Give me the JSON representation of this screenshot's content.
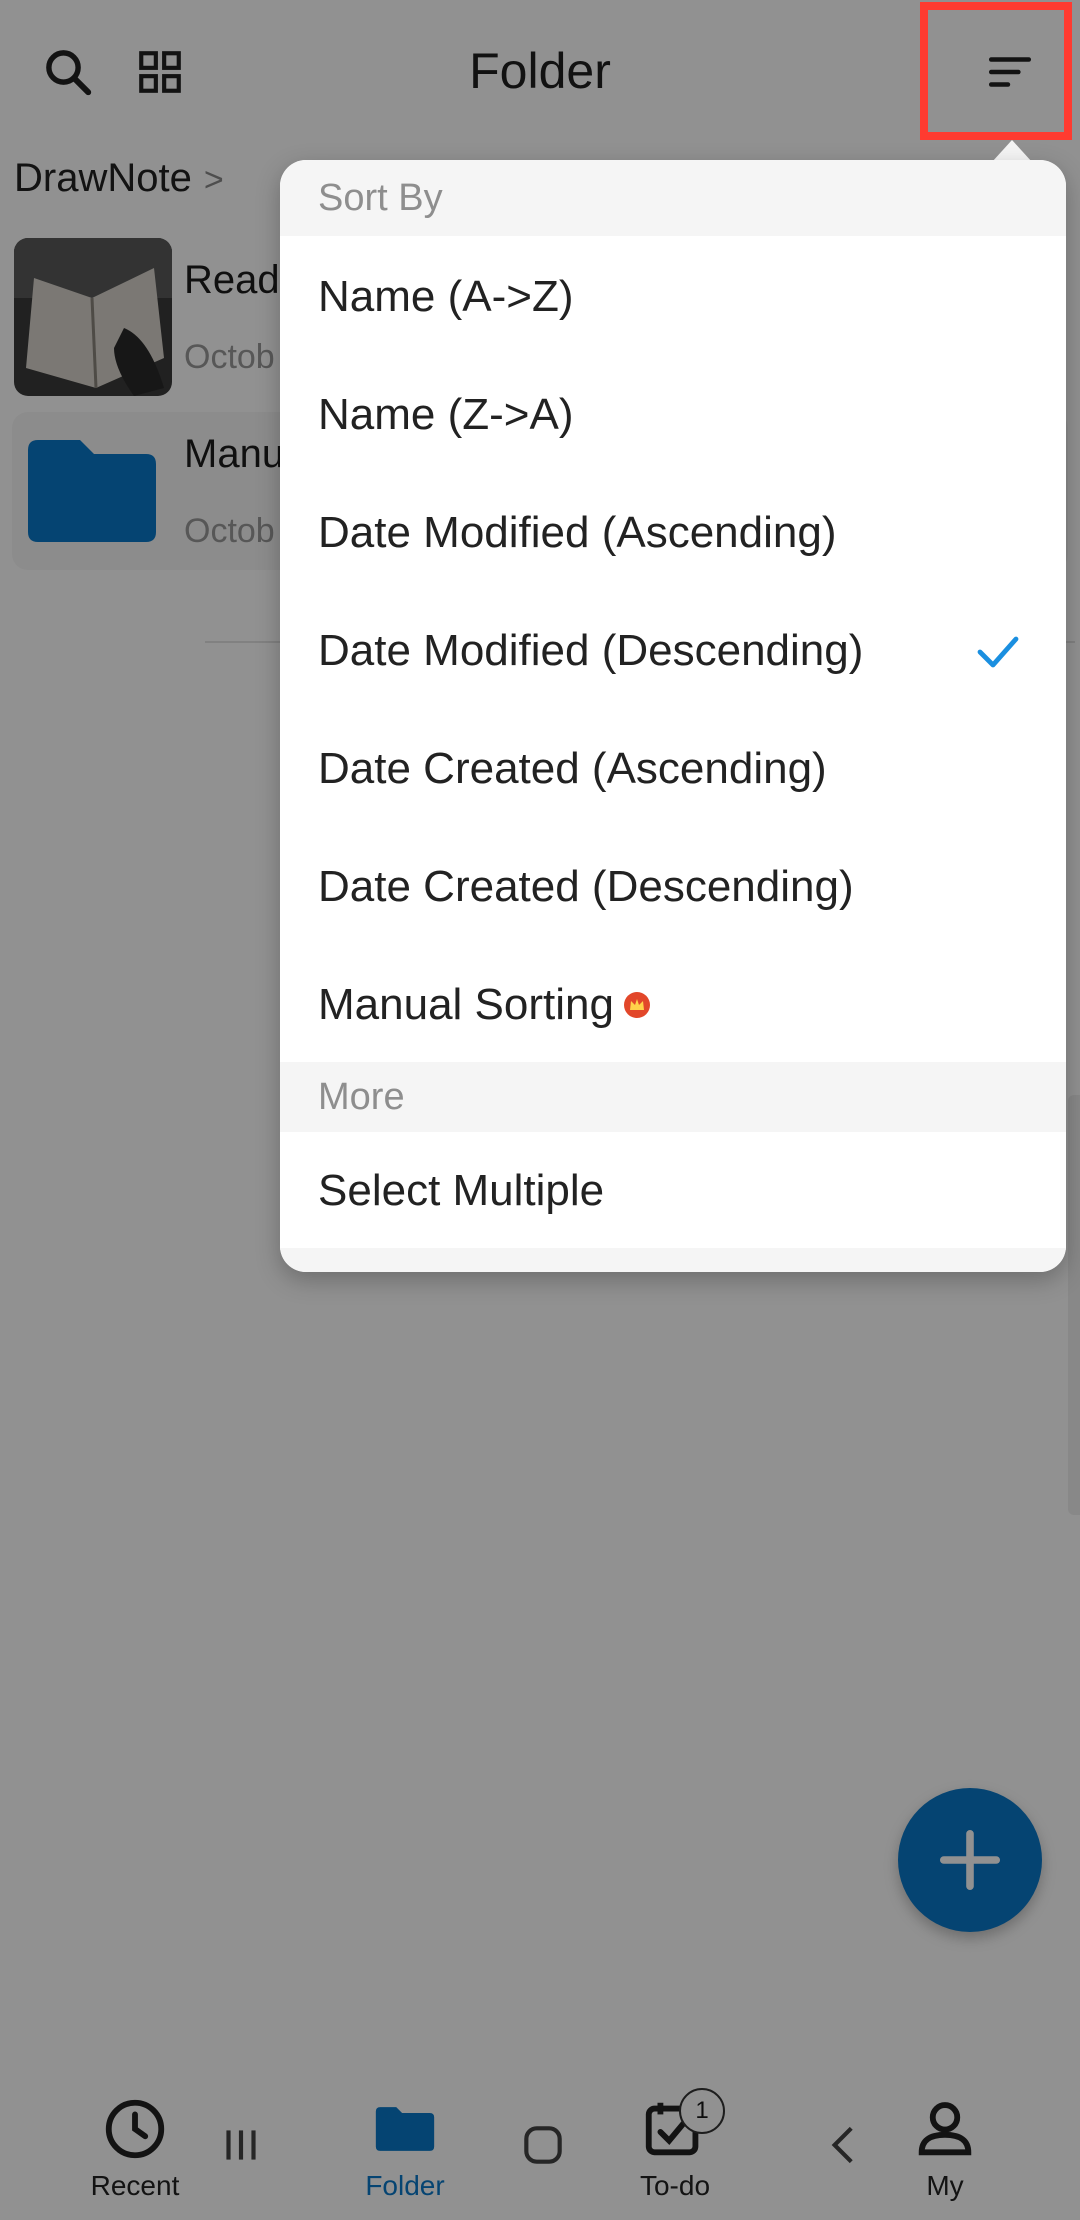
{
  "header": {
    "title": "Folder"
  },
  "breadcrumb": {
    "root": "DrawNote",
    "separator": ">"
  },
  "items": [
    {
      "name": "Readi",
      "date": "Octob"
    },
    {
      "name": "Manu",
      "date": "Octob"
    }
  ],
  "menu": {
    "sort_header": "Sort By",
    "options": [
      {
        "label": "Name (A->Z)"
      },
      {
        "label": "Name (Z->A)"
      },
      {
        "label": "Date Modified (Ascending)"
      },
      {
        "label": "Date Modified (Descending)",
        "selected": true
      },
      {
        "label": "Date Created (Ascending)"
      },
      {
        "label": "Date Created (Descending)"
      },
      {
        "label": "Manual Sorting",
        "badge_icon": "crown-icon"
      }
    ],
    "more_header": "More",
    "more_options": [
      {
        "label": "Select Multiple"
      }
    ]
  },
  "bottom_nav": {
    "items": [
      {
        "label": "Recent",
        "icon": "clock-icon"
      },
      {
        "label": "Folder",
        "icon": "folder-icon",
        "active": true
      },
      {
        "label": "To-do",
        "icon": "todo-icon",
        "badge": "1"
      },
      {
        "label": "My",
        "icon": "person-icon"
      }
    ]
  },
  "colors": {
    "accent": "#0a78c8",
    "highlight": "#ff3b30",
    "check": "#1a8fe0"
  }
}
